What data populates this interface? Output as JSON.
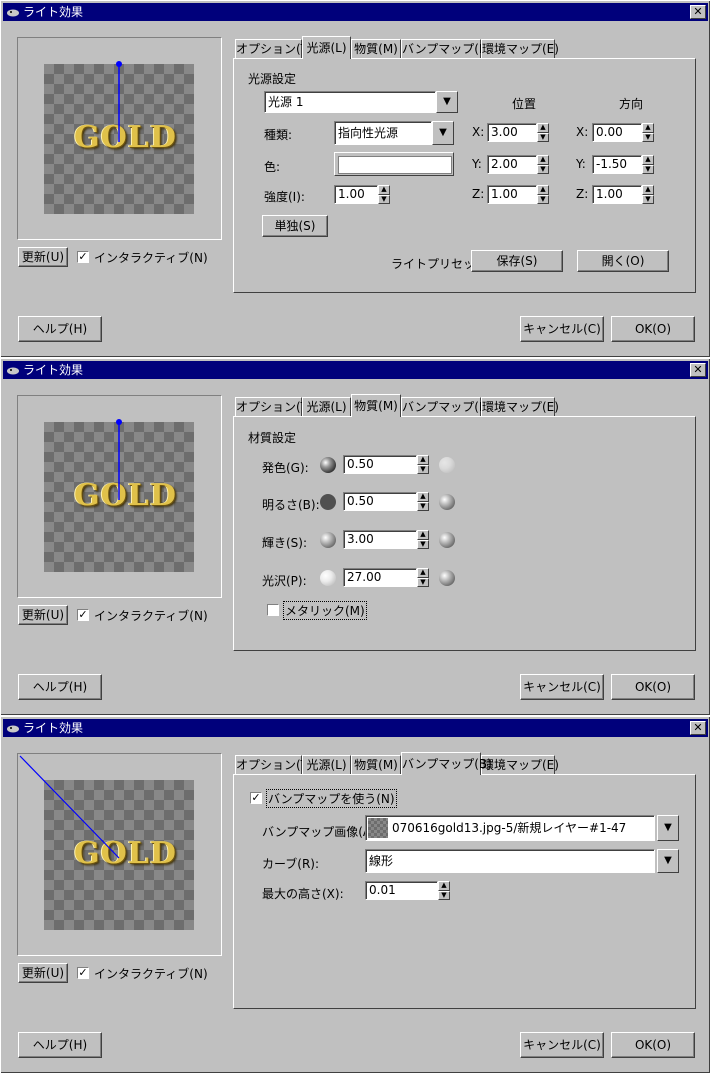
{
  "title": "ライト効果",
  "common": {
    "preview_text": "GOLD",
    "update_label": "更新(U)",
    "interactive_label": "インタラクティブ(N)",
    "help_label": "ヘルプ(H)",
    "cancel_label": "キャンセル(C)",
    "ok_label": "OK(O)"
  },
  "tabs": [
    "オプション(T)",
    "光源(L)",
    "物質(M)",
    "バンプマップ(B)",
    "環境マップ(E)"
  ],
  "light": {
    "section": "光源設定",
    "light_select": "光源 1",
    "position_header": "位置",
    "direction_header": "方向",
    "type_label": "種類:",
    "type_value": "指向性光源",
    "color_label": "色:",
    "intensity_label": "強度(I):",
    "intensity_value": "1.00",
    "isolate_label": "単独(S)",
    "pos_x_label": "X:",
    "pos_x": "3.00",
    "pos_y_label": "Y:",
    "pos_y": "2.00",
    "pos_z_label": "Z:",
    "pos_z": "1.00",
    "dir_x_label": "X:",
    "dir_x": "0.00",
    "dir_y_label": "Y:",
    "dir_y": "-1.50",
    "dir_z_label": "Z:",
    "dir_z": "1.00",
    "preset_label": "ライトプリセット:",
    "save_label": "保存(S)",
    "open_label": "開く(O)"
  },
  "material": {
    "section": "材質設定",
    "glow_label": "発色(G):",
    "glow_value": "0.50",
    "bright_label": "明るさ(B):",
    "bright_value": "0.50",
    "shine_label": "輝き(S):",
    "shine_value": "3.00",
    "polish_label": "光沢(P):",
    "polish_value": "27.00",
    "metallic_label": "メタリック(M)"
  },
  "bump": {
    "enable_label": "バンプマップを使う(N)",
    "image_label": "バンプマップ画像(A):",
    "image_value": "070616gold13.jpg-5/新規レイヤー#1-47",
    "curve_label": "カーブ(R):",
    "curve_value": "線形",
    "max_height_label": "最大の高さ(X):",
    "max_height_value": "0.01"
  }
}
